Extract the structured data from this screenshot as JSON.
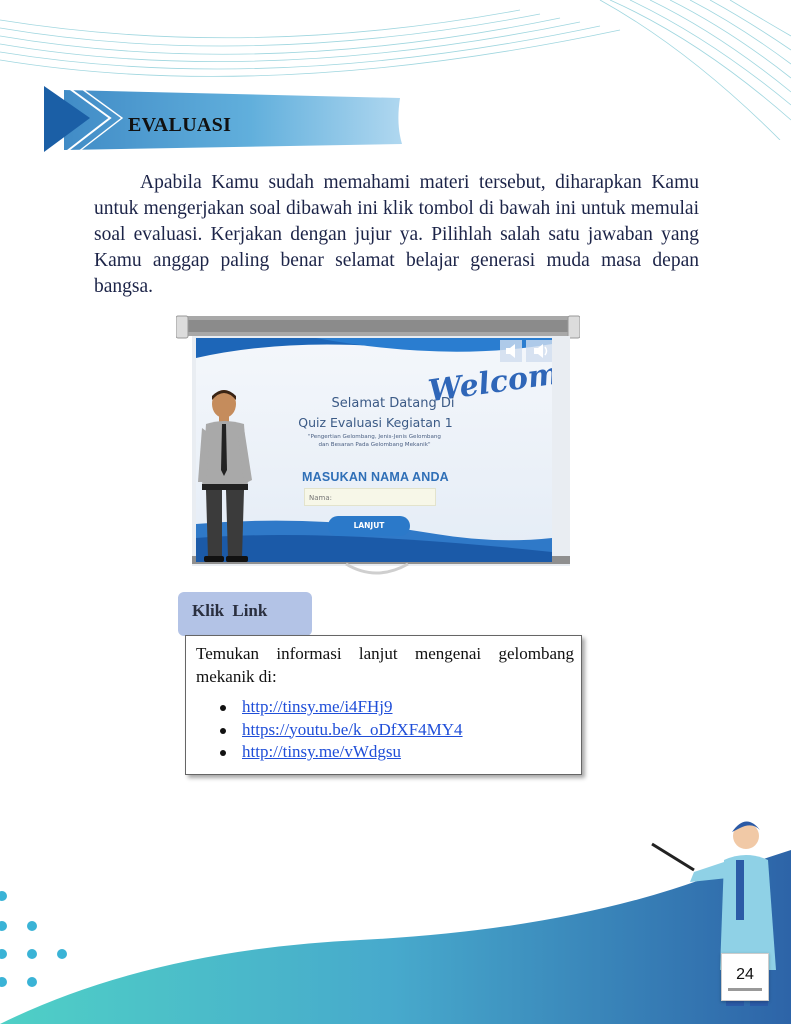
{
  "section": {
    "heading": "EVALUASI"
  },
  "intro": {
    "paragraph": "Apabila Kamu sudah memahami materi tersebut, diharapkan Kamu untuk mengerjakan soal dibawah ini klik tombol di bawah ini untuk memulai soal evaluasi. Kerjakan dengan jujur ya. Pilihlah salah satu jawaban yang Kamu anggap paling benar selamat belajar generasi muda masa depan bangsa."
  },
  "quiz_screen": {
    "welcome": "Welcome",
    "title_line1": "Selamat Datang Di",
    "title_line2": "Quiz Evaluasi Kegiatan 1",
    "subtitle_line1": "\"Pengertian Gelombang, Jenis-Jenis Gelombang",
    "subtitle_line2": "dan Besaran Pada Gelombang Mekanik\"",
    "name_label": "MASUKAN NAMA ANDA",
    "name_placeholder": "Nama:",
    "next_button": "LANJUT"
  },
  "link_section": {
    "tab_label": "Klik  Link",
    "description": "Temukan informasi lanjut mengenai gelombang mekanik di:",
    "links": [
      "http://tinsy.me/i4FHj9",
      "https://youtu.be/k_oDfXF4MY4",
      "http://tinsy.me/vWdgsu"
    ]
  },
  "page_number": "24",
  "colors": {
    "accent_blue": "#2b79c9",
    "tab_fill": "#b3c3e6",
    "wave_teal": "#4dc4c6",
    "link": "#1f4ed8"
  },
  "icons": [
    "speaker-icon",
    "play-triangle-icon",
    "bullet-dot-icon",
    "teacher-illustration",
    "businessman-illustration"
  ]
}
